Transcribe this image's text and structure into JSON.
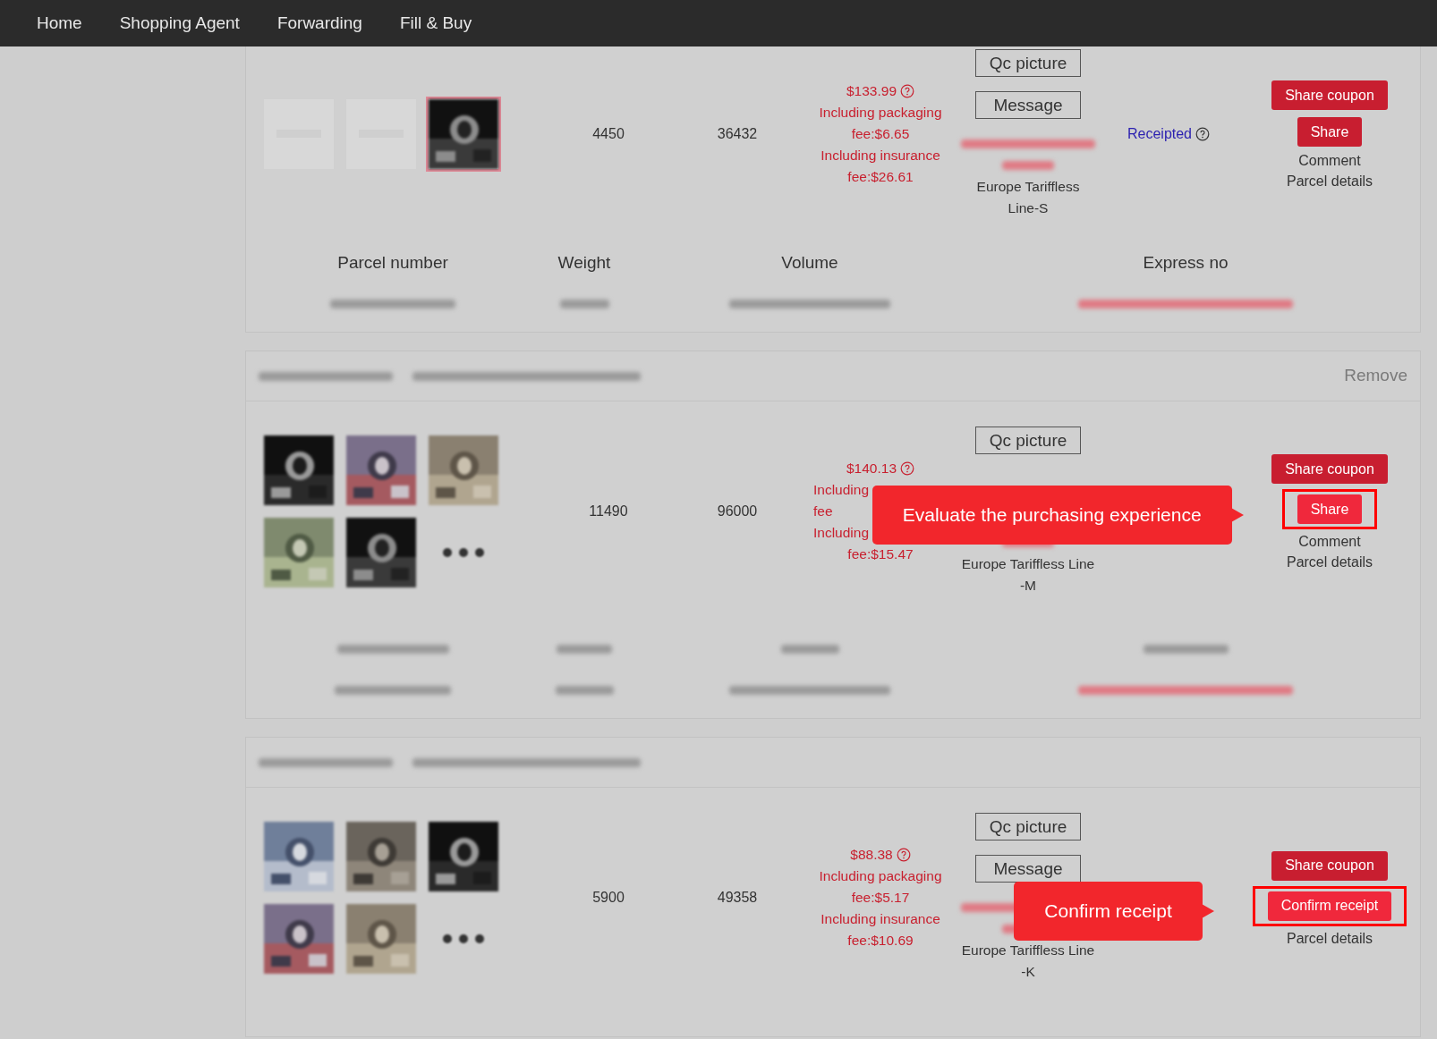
{
  "nav": {
    "items": [
      {
        "label": "Home"
      },
      {
        "label": "Shopping Agent"
      },
      {
        "label": "Forwarding"
      },
      {
        "label": "Fill & Buy"
      }
    ]
  },
  "orders": [
    {
      "images": [
        {
          "kind": "placeholder",
          "selected": false
        },
        {
          "kind": "placeholder",
          "selected": false
        },
        {
          "kind": "picture",
          "selected": true
        }
      ],
      "weight": "4450",
      "volume": "36432",
      "price": "$133.99",
      "fee_lines": [
        {
          "text": "Including packaging",
          "kind": "full"
        },
        {
          "text": "fee:$6.65",
          "kind": "full"
        },
        {
          "text": "Including insurance",
          "kind": "full"
        },
        {
          "text": "fee:$26.61",
          "kind": "full"
        }
      ],
      "buttons": [
        "Qc picture",
        "Message"
      ],
      "shipping_lines": [
        "Europe Tariffless",
        "Line-S"
      ],
      "status": {
        "text": "Receipted"
      },
      "actions": [
        {
          "label": "Share coupon",
          "kind": "button",
          "spotlight": false
        },
        {
          "label": "Share",
          "kind": "button",
          "spotlight": false
        },
        {
          "label": "Comment",
          "kind": "link",
          "spotlight": false
        },
        {
          "label": "Parcel details",
          "kind": "link",
          "spotlight": false
        }
      ],
      "parcel_table": {
        "kind": "table",
        "columns": [
          "Parcel number",
          "Weight",
          "Volume",
          "Express no"
        ]
      }
    },
    {
      "header": {
        "kind": "redacted",
        "remove": "Remove"
      },
      "images": [
        {
          "kind": "picture",
          "selected": false
        },
        {
          "kind": "picture",
          "selected": false
        },
        {
          "kind": "picture",
          "selected": false
        },
        {
          "kind": "picture",
          "selected": false
        },
        {
          "kind": "picture",
          "selected": false
        },
        {
          "kind": "more"
        }
      ],
      "weight": "11490",
      "volume": "96000",
      "price": "$140.13",
      "fee_lines": [
        {
          "text": "Including",
          "kind": "cut"
        },
        {
          "text": "fee",
          "kind": "cut"
        },
        {
          "text": "Including",
          "kind": "cut"
        },
        {
          "text": "fee:$15.47",
          "kind": "full"
        }
      ],
      "buttons": [
        "Qc picture"
      ],
      "shipping_lines": [
        "Europe Tariffless Line",
        "-M"
      ],
      "actions": [
        {
          "label": "Share coupon",
          "kind": "button",
          "spotlight": false
        },
        {
          "label": "Share",
          "kind": "button",
          "spotlight": true,
          "tooltip": "Evaluate the purchasing experience"
        },
        {
          "label": "Comment",
          "kind": "link",
          "spotlight": false
        },
        {
          "label": "Parcel details",
          "kind": "link",
          "spotlight": false
        }
      ],
      "parcel_table": {
        "kind": "redacted"
      }
    },
    {
      "header": {
        "kind": "redacted"
      },
      "images": [
        {
          "kind": "picture",
          "selected": false
        },
        {
          "kind": "picture",
          "selected": false
        },
        {
          "kind": "picture",
          "selected": false
        },
        {
          "kind": "picture",
          "selected": false
        },
        {
          "kind": "picture",
          "selected": false
        },
        {
          "kind": "more"
        }
      ],
      "weight": "5900",
      "volume": "49358",
      "price": "$88.38",
      "fee_lines": [
        {
          "text": "Including packaging",
          "kind": "full"
        },
        {
          "text": "fee:$5.17",
          "kind": "full"
        },
        {
          "text": "Including insurance",
          "kind": "full"
        },
        {
          "text": "fee:$10.69",
          "kind": "full"
        }
      ],
      "buttons": [
        "Qc picture",
        "Message"
      ],
      "shipping_lines": [
        "Europe Tariffless Line",
        "-K"
      ],
      "actions": [
        {
          "label": "Share coupon",
          "kind": "button",
          "spotlight": false
        },
        {
          "label": "Confirm receipt",
          "kind": "button",
          "spotlight": true,
          "tooltip": "Confirm receipt"
        },
        {
          "label": "Parcel details",
          "kind": "link",
          "spotlight": false
        }
      ]
    }
  ]
}
